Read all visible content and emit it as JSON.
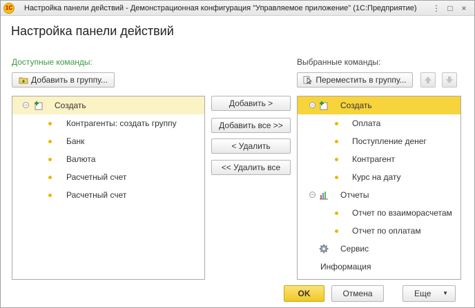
{
  "window": {
    "title": "Настройка панели действий - Демонстрационная конфигурация \"Управляемое приложение\" (1С:Предприятие)",
    "logo_text": "1C",
    "buttons": [
      "⋮",
      "□",
      "×"
    ]
  },
  "heading": "Настройка панели действий",
  "available": {
    "label": "Доступные команды:",
    "add_to_group": "Добавить в группу...",
    "tree": {
      "group": "Создать",
      "items": [
        "Контрагенты: создать группу",
        "Банк",
        "Валюта",
        "Расчетный счет",
        "Расчетный счет"
      ]
    }
  },
  "middle_buttons": {
    "add": "Добавить >",
    "add_all": "Добавить все >>",
    "remove": "< Удалить",
    "remove_all": "<< Удалить все"
  },
  "selected": {
    "label": "Выбранные команды:",
    "move_to_group": "Переместить в группу...",
    "tree": {
      "group_create": "Создать",
      "create_items": [
        "Оплата",
        "Поступление денег",
        "Контрагент",
        "Курс на дату"
      ],
      "group_reports": "Отчеты",
      "report_items": [
        "Отчет по взаиморасчетам",
        "Отчет по оплатам"
      ],
      "service": "Сервис",
      "info": "Информация"
    }
  },
  "footer": {
    "ok": "OK",
    "cancel": "Отмена",
    "more": "Еще"
  },
  "colors": {
    "accent_yellow": "#f7d33c",
    "available_label": "#3a9a46"
  }
}
